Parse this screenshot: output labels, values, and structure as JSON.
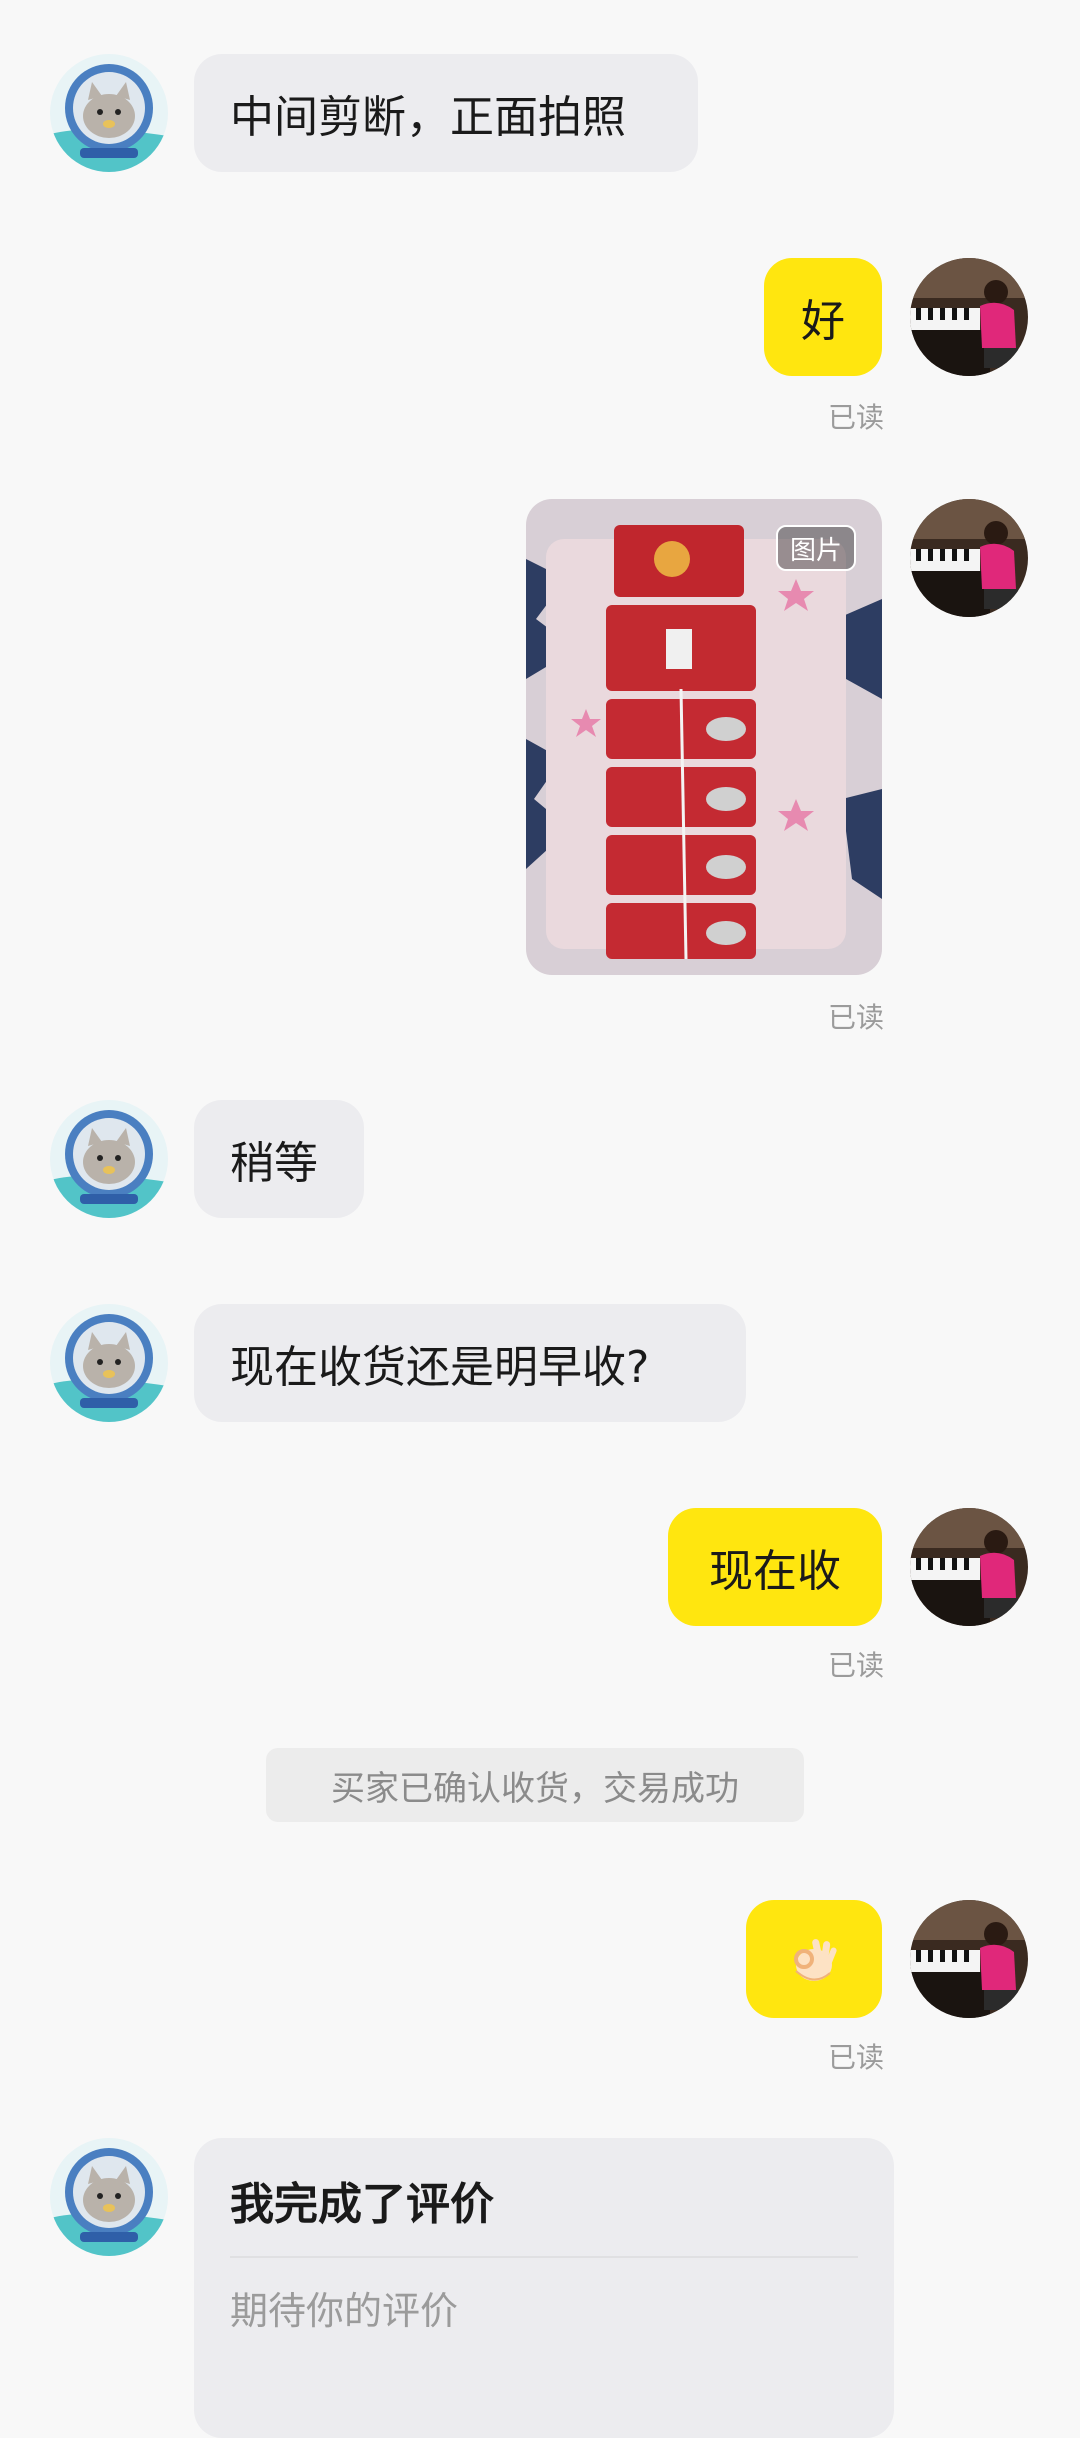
{
  "messages": {
    "m1": {
      "sender": "other",
      "text": "中间剪断，正面拍照"
    },
    "m2": {
      "sender": "me",
      "text": "好",
      "status": "已读"
    },
    "m3": {
      "sender": "me",
      "image_tag": "图片",
      "status": "已读"
    },
    "m4": {
      "sender": "other",
      "text": "稍等"
    },
    "m5": {
      "sender": "other",
      "text": "现在收货还是明早收?"
    },
    "m6": {
      "sender": "me",
      "text": "现在收",
      "status": "已读"
    },
    "m7": {
      "sender": "me",
      "emoji": "👌",
      "status": "已读"
    }
  },
  "system_notice": "买家已确认收货，交易成功",
  "review_card": {
    "title": "我完成了评价",
    "subtitle": "期待你的评价"
  },
  "colors": {
    "background": "#f8f8f8",
    "incoming_bubble": "#ececef",
    "outgoing_bubble": "#ffe60f",
    "read_status": "#9b9b9b"
  },
  "icons": {
    "other_avatar": "cat-astronaut-avatar",
    "my_avatar": "piano-girl-avatar",
    "ok_hand": "ok-hand-emoji"
  }
}
